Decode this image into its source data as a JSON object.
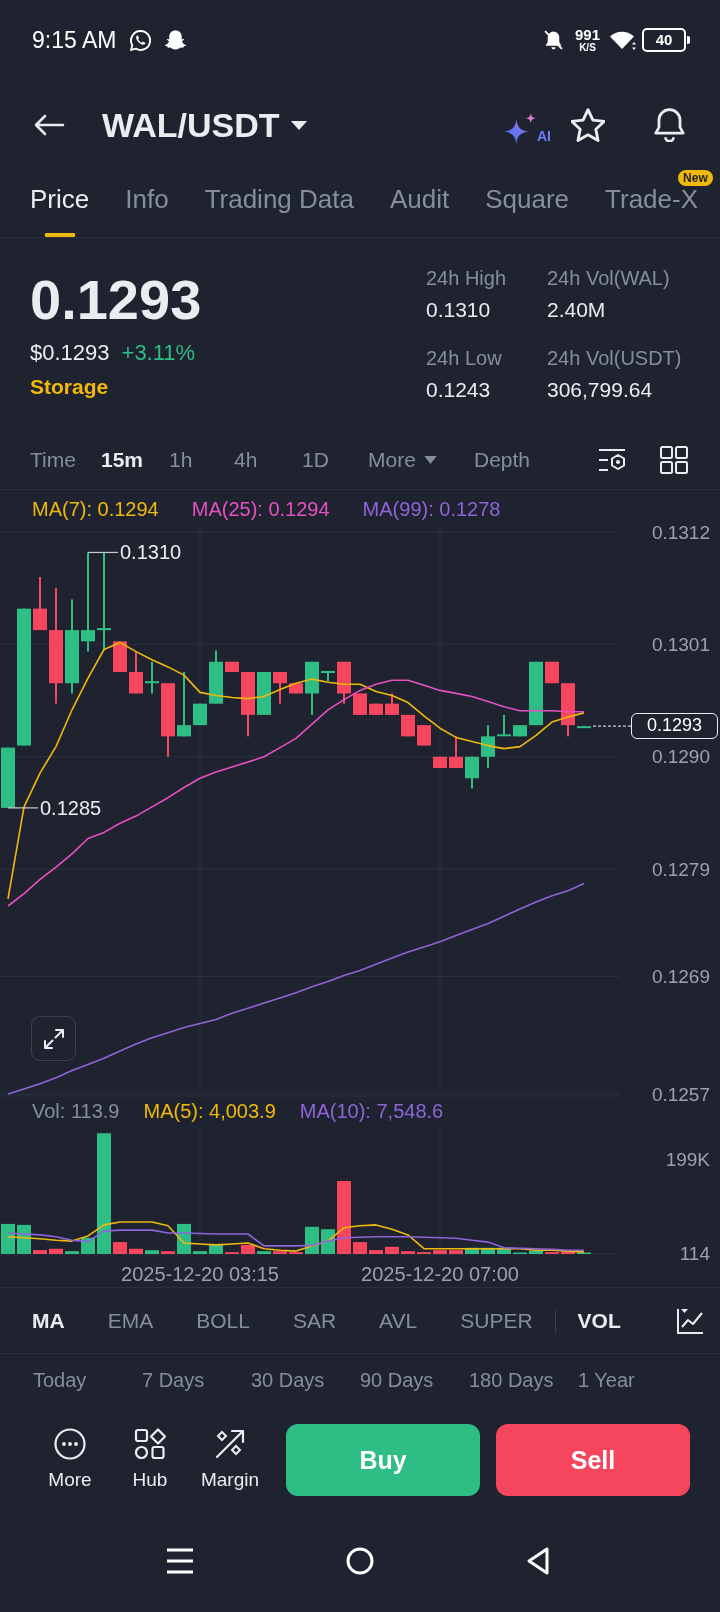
{
  "status_bar": {
    "time": "9:15 AM",
    "network_speed": "991",
    "speed_unit": "K/S",
    "battery": "40"
  },
  "header": {
    "pair": "WAL/USDT",
    "ai_label": "AI"
  },
  "tabs": [
    {
      "label": "Price",
      "selected": true
    },
    {
      "label": "Info",
      "selected": false
    },
    {
      "label": "Trading Data",
      "selected": false
    },
    {
      "label": "Audit",
      "selected": false
    },
    {
      "label": "Square",
      "selected": false
    },
    {
      "label": "Trade-X",
      "selected": false,
      "badge": "New"
    }
  ],
  "ticker": {
    "price": "0.1293",
    "usd_price": "$0.1293",
    "change": "+3.11%",
    "tag": "Storage",
    "stats": [
      {
        "label": "24h High",
        "value": "0.1310"
      },
      {
        "label": "24h Vol(WAL)",
        "value": "2.40M"
      },
      {
        "label": "24h Low",
        "value": "0.1243"
      },
      {
        "label": "24h Vol(USDT)",
        "value": "306,799.64"
      }
    ]
  },
  "intervals": [
    {
      "label": "Time",
      "selected": false,
      "kind": "option"
    },
    {
      "label": "15m",
      "selected": true,
      "kind": "option"
    },
    {
      "label": "1h",
      "selected": false,
      "kind": "option"
    },
    {
      "label": "4h",
      "selected": false,
      "kind": "option"
    },
    {
      "label": "1D",
      "selected": false,
      "kind": "option"
    },
    {
      "label": "More",
      "selected": false,
      "kind": "dropdown"
    },
    {
      "label": "Depth",
      "selected": false,
      "kind": "option"
    }
  ],
  "chart": {
    "chart_data": {
      "type": "candlestick",
      "grid": true,
      "categories": [
        null,
        null,
        null,
        null,
        null,
        null,
        null,
        null,
        null,
        null,
        null,
        null,
        null,
        null,
        null,
        null,
        null,
        null,
        null,
        null,
        null,
        null,
        null,
        null,
        null,
        null,
        null,
        null,
        null,
        null,
        null,
        null,
        null,
        null,
        null,
        null,
        null,
        null,
        null,
        null,
        null,
        null,
        null,
        null,
        null
      ],
      "ylim": [
        0.1257,
        0.1312
      ],
      "yticks": [
        {
          "value": 0.1312,
          "label": "0.1312"
        },
        {
          "value": 0.1301,
          "label": "0.1301"
        },
        {
          "value": 0.129,
          "label": "0.1290"
        },
        {
          "value": 0.1279,
          "label": "0.1279"
        },
        {
          "value": 0.12685,
          "label": "0.1269"
        },
        {
          "value": 0.1257,
          "label": "0.1257"
        }
      ],
      "ohlc": [
        [
          0.1285,
          0.12909,
          0.1285,
          0.12909
        ],
        [
          0.12911,
          0.13045,
          0.12911,
          0.13045
        ],
        [
          0.13045,
          0.13076,
          0.13024,
          0.13024
        ],
        [
          0.13024,
          0.13065,
          0.12952,
          0.12972
        ],
        [
          0.12972,
          0.13054,
          0.12962,
          0.13024
        ],
        [
          0.13013,
          0.131,
          0.13003,
          0.13024
        ],
        [
          0.13024,
          0.131,
          0.13004,
          0.13026
        ],
        [
          0.13013,
          0.13013,
          0.12983,
          0.12983
        ],
        [
          0.12983,
          0.13003,
          0.12962,
          0.12962
        ],
        [
          0.12973,
          0.12993,
          0.12962,
          0.12974
        ],
        [
          0.12972,
          0.12972,
          0.129,
          0.1292
        ],
        [
          0.1292,
          0.12983,
          0.1292,
          0.12931
        ],
        [
          0.12931,
          0.12952,
          0.12931,
          0.12952
        ],
        [
          0.12952,
          0.13004,
          0.12952,
          0.12993
        ],
        [
          0.12993,
          0.12993,
          0.12983,
          0.12983
        ],
        [
          0.12983,
          0.12983,
          0.1292,
          0.12941
        ],
        [
          0.12941,
          0.12983,
          0.12941,
          0.12983
        ],
        [
          0.12983,
          0.12983,
          0.12952,
          0.12972
        ],
        [
          0.12972,
          0.12972,
          0.12962,
          0.12962
        ],
        [
          0.12962,
          0.12993,
          0.12941,
          0.12993
        ],
        [
          0.12982,
          0.12984,
          0.12974,
          0.12984
        ],
        [
          0.12993,
          0.12993,
          0.12952,
          0.12962
        ],
        [
          0.12962,
          0.12962,
          0.12941,
          0.12941
        ],
        [
          0.12952,
          0.12952,
          0.12941,
          0.12941
        ],
        [
          0.12952,
          0.12962,
          0.12941,
          0.12941
        ],
        [
          0.12941,
          0.12941,
          0.1292,
          0.1292
        ],
        [
          0.12931,
          0.12931,
          0.12911,
          0.12911
        ],
        [
          0.129,
          0.129,
          0.12889,
          0.12889
        ],
        [
          0.129,
          0.1292,
          0.12889,
          0.12889
        ],
        [
          0.12879,
          0.129,
          0.12869,
          0.129
        ],
        [
          0.129,
          0.12931,
          0.12889,
          0.1292
        ],
        [
          0.12921,
          0.12941,
          0.12921,
          0.12922
        ],
        [
          0.1292,
          0.12931,
          0.1292,
          0.12931
        ],
        [
          0.12931,
          0.12993,
          0.12931,
          0.12993
        ],
        [
          0.12993,
          0.12993,
          0.12972,
          0.12972
        ],
        [
          0.12972,
          0.12972,
          0.1292,
          0.12931
        ],
        [
          0.1293,
          0.1293,
          0.12929,
          0.1293
        ],
        null,
        null,
        null,
        null,
        null,
        null,
        null,
        null
      ],
      "series": [
        {
          "name": "MA(7): 0.1294",
          "type": "line",
          "color": "#f0b90b",
          "values": [
            0.12761,
            0.12851,
            0.12884,
            0.1291,
            0.12946,
            0.12977,
            0.13005,
            0.13012,
            0.13003,
            0.12995,
            0.12988,
            0.1298,
            0.12963,
            0.1296,
            0.12958,
            0.12957,
            0.12959,
            0.12966,
            0.12972,
            0.12976,
            0.12973,
            0.12971,
            0.12971,
            0.12964,
            0.1296,
            0.12953,
            0.1294,
            0.12928,
            0.12919,
            0.12915,
            0.12911,
            0.12908,
            0.1291,
            0.12921,
            0.12934,
            0.12939,
            0.12943,
            null,
            null,
            null,
            null,
            null,
            null,
            null,
            null
          ]
        },
        {
          "name": "MA(25): 0.1294",
          "type": "line",
          "color": "#e84fc4",
          "values": [
            0.12754,
            0.12766,
            0.1278,
            0.12792,
            0.12805,
            0.1282,
            0.12826,
            0.12835,
            0.12842,
            0.12851,
            0.1286,
            0.1287,
            0.12879,
            0.12885,
            0.1289,
            0.12895,
            0.129,
            0.12909,
            0.12918,
            0.12932,
            0.12946,
            0.12956,
            0.12965,
            0.12971,
            0.12975,
            0.12975,
            0.1297,
            0.12965,
            0.12962,
            0.12959,
            0.12954,
            0.12949,
            0.12945,
            0.12945,
            0.12945,
            0.12944,
            0.12944,
            null,
            null,
            null,
            null,
            null,
            null,
            null,
            null
          ]
        },
        {
          "name": "MA(99): 0.1278",
          "type": "line",
          "color": "#8e64d8",
          "values": [
            0.1257,
            0.12575,
            0.1258,
            0.12586,
            0.12593,
            0.12599,
            0.12605,
            0.12612,
            0.12619,
            0.12625,
            0.1263,
            0.12635,
            0.12639,
            0.12643,
            0.12649,
            0.12654,
            0.12659,
            0.12664,
            0.12669,
            0.12675,
            0.1268,
            0.12686,
            0.12691,
            0.12697,
            0.12703,
            0.12709,
            0.12714,
            0.12719,
            0.12725,
            0.12731,
            0.12737,
            0.12744,
            0.12751,
            0.12758,
            0.12764,
            0.12769,
            0.12776,
            null,
            null,
            null,
            null,
            null,
            null,
            null,
            null
          ]
        }
      ],
      "annotations": [
        "0.1310",
        "0.1285",
        "0.1293"
      ]
    }
  },
  "volume": {
    "chart_data": {
      "type": "bar",
      "grid": true,
      "categories": [
        null,
        null,
        null,
        null,
        null,
        null,
        null,
        null,
        null,
        null,
        null,
        null,
        "2025-12-20 03:15",
        null,
        null,
        null,
        null,
        null,
        null,
        null,
        null,
        null,
        null,
        null,
        null,
        null,
        null,
        "2025-12-20 07:00",
        null,
        null,
        null,
        null,
        null,
        null,
        null,
        null,
        null,
        null,
        null,
        null,
        null,
        null,
        null,
        null,
        null
      ],
      "ylim": [
        0,
        331000
      ],
      "yticks": [
        {
          "value": 114,
          "label": "114"
        },
        {
          "value": 199000,
          "label": "199K"
        }
      ],
      "series": [
        {
          "name": "Vol: 113.9",
          "colors": [
            "#2ebd85",
            "#2ebd85",
            "#f6465d",
            "#f6465d",
            "#2ebd85",
            "#2ebd85",
            "#2ebd85",
            "#f6465d",
            "#f6465d",
            "#2ebd85",
            "#f6465d",
            "#2ebd85",
            "#2ebd85",
            "#2ebd85",
            "#f6465d",
            "#f6465d",
            "#2ebd85",
            "#f6465d",
            "#f6465d",
            "#2ebd85",
            "#2ebd85",
            "#f6465d",
            "#f6465d",
            "#f6465d",
            "#f6465d",
            "#f6465d",
            "#f6465d",
            "#f6465d",
            "#f6465d",
            "#2ebd85",
            "#2ebd85",
            "#2ebd85",
            "#2ebd85",
            "#2ebd85",
            "#f6465d",
            "#f6465d",
            "#2ebd85",
            null,
            null,
            null,
            null,
            null,
            null,
            null,
            null
          ],
          "values": [
            63000,
            61000,
            8000,
            11000,
            6000,
            34000,
            253000,
            25000,
            11000,
            8000,
            6000,
            63000,
            6000,
            21000,
            4000,
            19000,
            6000,
            6000,
            4000,
            57000,
            52000,
            153000,
            25000,
            8000,
            15000,
            6000,
            4000,
            8000,
            8000,
            13000,
            13000,
            13000,
            3000,
            7000,
            4000,
            6000,
            0,
            null,
            null,
            null,
            null,
            null,
            null,
            null,
            null
          ]
        },
        {
          "name": "MA(5): 4,003.9",
          "type": "line",
          "color": "#f0b90b",
          "values": [
            36000,
            34000,
            32000,
            29000,
            27000,
            38000,
            61000,
            67000,
            67000,
            67000,
            59000,
            23000,
            21000,
            19000,
            21000,
            23000,
            11000,
            8000,
            6000,
            17000,
            27000,
            55000,
            59000,
            61000,
            52000,
            40000,
            11000,
            11000,
            11000,
            11000,
            11000,
            11000,
            11000,
            8000,
            8000,
            6000,
            4000,
            null,
            null,
            null,
            null,
            null,
            null,
            null,
            null
          ]
        },
        {
          "name": "MA(10): 7,548.6",
          "type": "line",
          "color": "#8e64d8",
          "values": [
            44000,
            42000,
            40000,
            36000,
            29000,
            26000,
            48000,
            50000,
            50000,
            50000,
            44000,
            44000,
            43000,
            42000,
            42000,
            42000,
            17000,
            17000,
            17000,
            18000,
            27000,
            34000,
            35000,
            36000,
            36000,
            36000,
            35000,
            34000,
            33000,
            29000,
            25000,
            13000,
            12000,
            11000,
            10000,
            8000,
            8000,
            null,
            null,
            null,
            null,
            null,
            null,
            null,
            null
          ]
        }
      ]
    }
  },
  "indicators": {
    "main": [
      {
        "label": "MA",
        "selected": true
      },
      {
        "label": "EMA",
        "selected": false
      },
      {
        "label": "BOLL",
        "selected": false
      },
      {
        "label": "SAR",
        "selected": false
      },
      {
        "label": "AVL",
        "selected": false
      },
      {
        "label": "SUPER",
        "selected": false
      }
    ],
    "sub": [
      {
        "label": "VOL",
        "selected": true
      }
    ]
  },
  "periods": [
    "Today",
    "7 Days",
    "30 Days",
    "90 Days",
    "180 Days",
    "1 Year"
  ],
  "actions": [
    {
      "label": "More",
      "kind": "more"
    },
    {
      "label": "Hub",
      "kind": "hub"
    },
    {
      "label": "Margin",
      "kind": "margin"
    }
  ],
  "trade_buttons": [
    {
      "label": "Buy",
      "kind": "buy"
    },
    {
      "label": "Sell",
      "kind": "sell"
    }
  ]
}
